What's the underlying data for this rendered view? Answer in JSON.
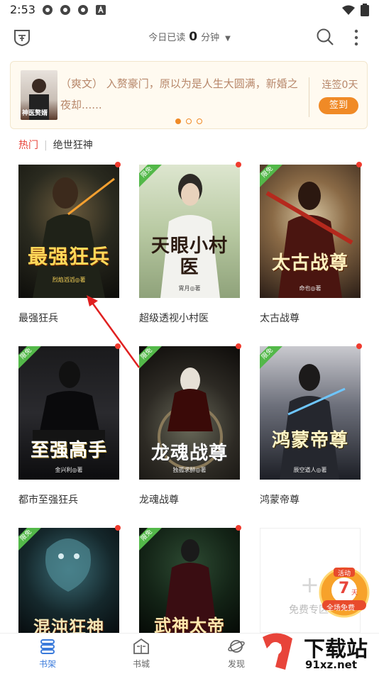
{
  "status": {
    "time": "2:53",
    "icons": [
      "app-icon",
      "app-icon",
      "app-icon",
      "a-icon"
    ]
  },
  "header": {
    "reading_prefix": "今日已读",
    "reading_minutes": "0",
    "reading_unit": "分钟"
  },
  "banner": {
    "cover_title": "神医赘婿",
    "text": "（爽文） 入赘豪门，原以为是人生大圆满，新婚之夜却......",
    "sign_days": "连签0天",
    "sign_button": "签到",
    "dots": 3
  },
  "tags": {
    "hot": "热门",
    "current": "绝世狂神"
  },
  "books": [
    {
      "title": "最强狂兵",
      "cover_text": "最强狂兵",
      "author": "烈焰滔滔◎著",
      "free": false
    },
    {
      "title": "超级透视小村医",
      "cover_text": "天眼小村医",
      "author": "霄月◎著",
      "free": true
    },
    {
      "title": "太古战尊",
      "cover_text": "太古战尊",
      "author": "命也◎著",
      "free": true
    },
    {
      "title": "都市至强狂兵",
      "cover_text": "至强高手",
      "author": "金兴利◎著",
      "free": true
    },
    {
      "title": "龙魂战尊",
      "cover_text": "龙魂战尊",
      "author": "独孤求醉◎著",
      "free": true
    },
    {
      "title": "鸿蒙帝尊",
      "cover_text": "鸿蒙帝尊",
      "author": "辰空道人◎著",
      "free": true
    },
    {
      "title": "",
      "cover_text": "混沌狂神",
      "author": "",
      "free": true
    },
    {
      "title": "",
      "cover_text": "武神太帝",
      "author": "",
      "free": true
    }
  ],
  "ribbon_label": "限免",
  "free_zone": {
    "label": "免费专区"
  },
  "promo": {
    "top": "活动",
    "days": "7",
    "unit": "天",
    "bottom": "全场免费"
  },
  "tabs": [
    {
      "label": "书架",
      "icon": "bookshelf-icon",
      "active": true
    },
    {
      "label": "书城",
      "icon": "bookstore-icon",
      "active": false
    },
    {
      "label": "发现",
      "icon": "planet-icon",
      "active": false
    }
  ],
  "watermark": {
    "main": "下载站",
    "sub": "91xz.net"
  },
  "colors": {
    "accent": "#3b7bdb",
    "orange": "#f08a26",
    "hot": "#e8443a",
    "free_green": "#53b849"
  }
}
